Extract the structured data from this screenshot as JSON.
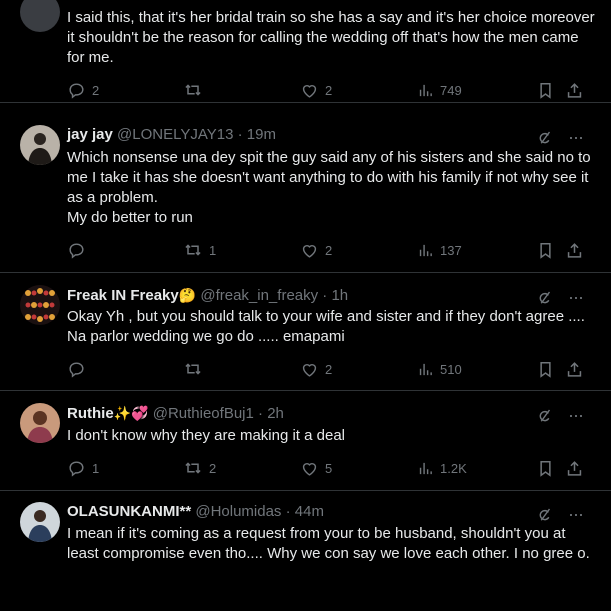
{
  "tweets": [
    {
      "text": "I said this, that it's her bridal train so she has a say and it's her choice moreover it shouldn't be the reason for calling the wedding off that's how the men came for me.",
      "reply": "2",
      "retweet": "",
      "like": "2",
      "views": "749"
    },
    {
      "name": "jay jay",
      "handle": "@LONELYJAY13",
      "time": "19m",
      "text": "Which nonsense una dey spit the guy said any of his sisters and she said no to me I take it has she doesn't want anything to do with his family if not why see it as a problem.",
      "text2": "My do better to run",
      "reply": "",
      "retweet": "1",
      "like": "2",
      "views": "137"
    },
    {
      "name": "Freak IN Freaky",
      "name_emoji": "🤔",
      "handle": "@freak_in_freaky",
      "time": "1h",
      "text": "Okay Yh , but you should talk to your wife and sister and if they don't agree .... Na parlor wedding we go do ..... emapami",
      "reply": "",
      "retweet": "",
      "like": "2",
      "views": "510"
    },
    {
      "name": "Ruthie",
      "name_emoji": "✨💞",
      "handle": "@RuthieofBuj1",
      "time": "2h",
      "text": "I don't know why they are making it a deal",
      "reply": "1",
      "retweet": "2",
      "like": "5",
      "views": "1.2K"
    },
    {
      "name": "OLASUNKANMI**",
      "handle": "@Holumidas",
      "time": "44m",
      "text": "I mean if it's coming as a request from your to be husband, shouldn't you at least compromise even tho.... Why we con say we love each other. I no gree o."
    }
  ],
  "separator": "·",
  "colors": {
    "text": "#e7e9ea",
    "muted": "#71767b",
    "border": "#2f3336",
    "bg": "#000000"
  },
  "icons": [
    "reply-icon",
    "retweet-icon",
    "like-icon",
    "views-icon",
    "bookmark-icon",
    "share-icon",
    "grok-icon",
    "more-icon"
  ]
}
